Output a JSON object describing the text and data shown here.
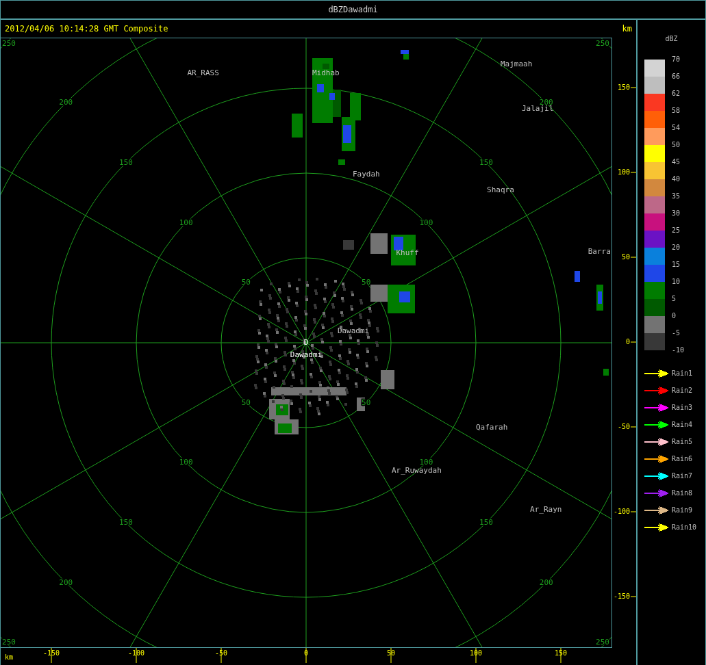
{
  "window": {
    "title": "dBZDawadmi"
  },
  "header": {
    "timestamp": "2012/04/06 10:14:28 GMT Composite",
    "y_unit": "km"
  },
  "radar": {
    "site": {
      "marker": "D",
      "name": "Dawadmi"
    },
    "rings": [
      {
        "labels": [
          "50",
          "50",
          "50",
          "50"
        ]
      },
      {
        "labels": [
          "100",
          "100",
          "100",
          "100"
        ]
      },
      {
        "labels": [
          "150",
          "150",
          "150",
          "150"
        ]
      },
      {
        "labels": [
          "200",
          "200",
          "200",
          "200"
        ]
      },
      {
        "labels": [
          "250",
          "250",
          "250",
          "250"
        ]
      }
    ],
    "cities": [
      {
        "name": "AR_RASS"
      },
      {
        "name": "Midhab"
      },
      {
        "name": "Majmaah"
      },
      {
        "name": "Jalajil"
      },
      {
        "name": "Faydah"
      },
      {
        "name": "Shaqra"
      },
      {
        "name": "Khuff"
      },
      {
        "name": "Barra"
      },
      {
        "name": "Dawadmi"
      },
      {
        "name": "Qafarah"
      },
      {
        "name": "Ar_Ruwaydah"
      },
      {
        "name": "Ar_Rayn"
      }
    ]
  },
  "y_axis": {
    "ticks": [
      "150",
      "100",
      "50",
      "0",
      "-50",
      "-100",
      "-150"
    ]
  },
  "x_axis": {
    "unit": "km",
    "ticks": [
      "-150",
      "-100",
      "-50",
      "0",
      "50",
      "100",
      "150"
    ]
  },
  "legend": {
    "title": "dBZ",
    "bands": [
      {
        "color": "#d3d3d3"
      },
      {
        "color": "#bebebe"
      },
      {
        "color": "#fa3822"
      },
      {
        "color": "#ff5f08"
      },
      {
        "color": "#ff9b5c"
      },
      {
        "color": "#ffff00"
      },
      {
        "color": "#f8c433"
      },
      {
        "color": "#d2883e"
      },
      {
        "color": "#bd6888"
      },
      {
        "color": "#c8117e"
      },
      {
        "color": "#6b12c4"
      },
      {
        "color": "#0a80dc"
      },
      {
        "color": "#1f47e8"
      },
      {
        "color": "#007c00"
      },
      {
        "color": "#005a00"
      },
      {
        "color": "#737373"
      },
      {
        "color": "#383838"
      }
    ],
    "labels": [
      "70",
      "66",
      "62",
      "58",
      "54",
      "50",
      "45",
      "40",
      "35",
      "30",
      "25",
      "20",
      "15",
      "10",
      "5",
      "0",
      "-5",
      "-10"
    ]
  },
  "rain_legend": [
    {
      "label": "Rain1",
      "color": "#ffff00"
    },
    {
      "label": "Rain2",
      "color": "#ff0000"
    },
    {
      "label": "Rain3",
      "color": "#ff00ff"
    },
    {
      "label": "Rain4",
      "color": "#00ff00"
    },
    {
      "label": "Rain5",
      "color": "#ffc0cb"
    },
    {
      "label": "Rain6",
      "color": "#ffa500"
    },
    {
      "label": "Rain7",
      "color": "#00ffff"
    },
    {
      "label": "Rain8",
      "color": "#a020f0"
    },
    {
      "label": "Rain9",
      "color": "#deb887"
    },
    {
      "label": "Rain10",
      "color": "#ffff00"
    }
  ]
}
